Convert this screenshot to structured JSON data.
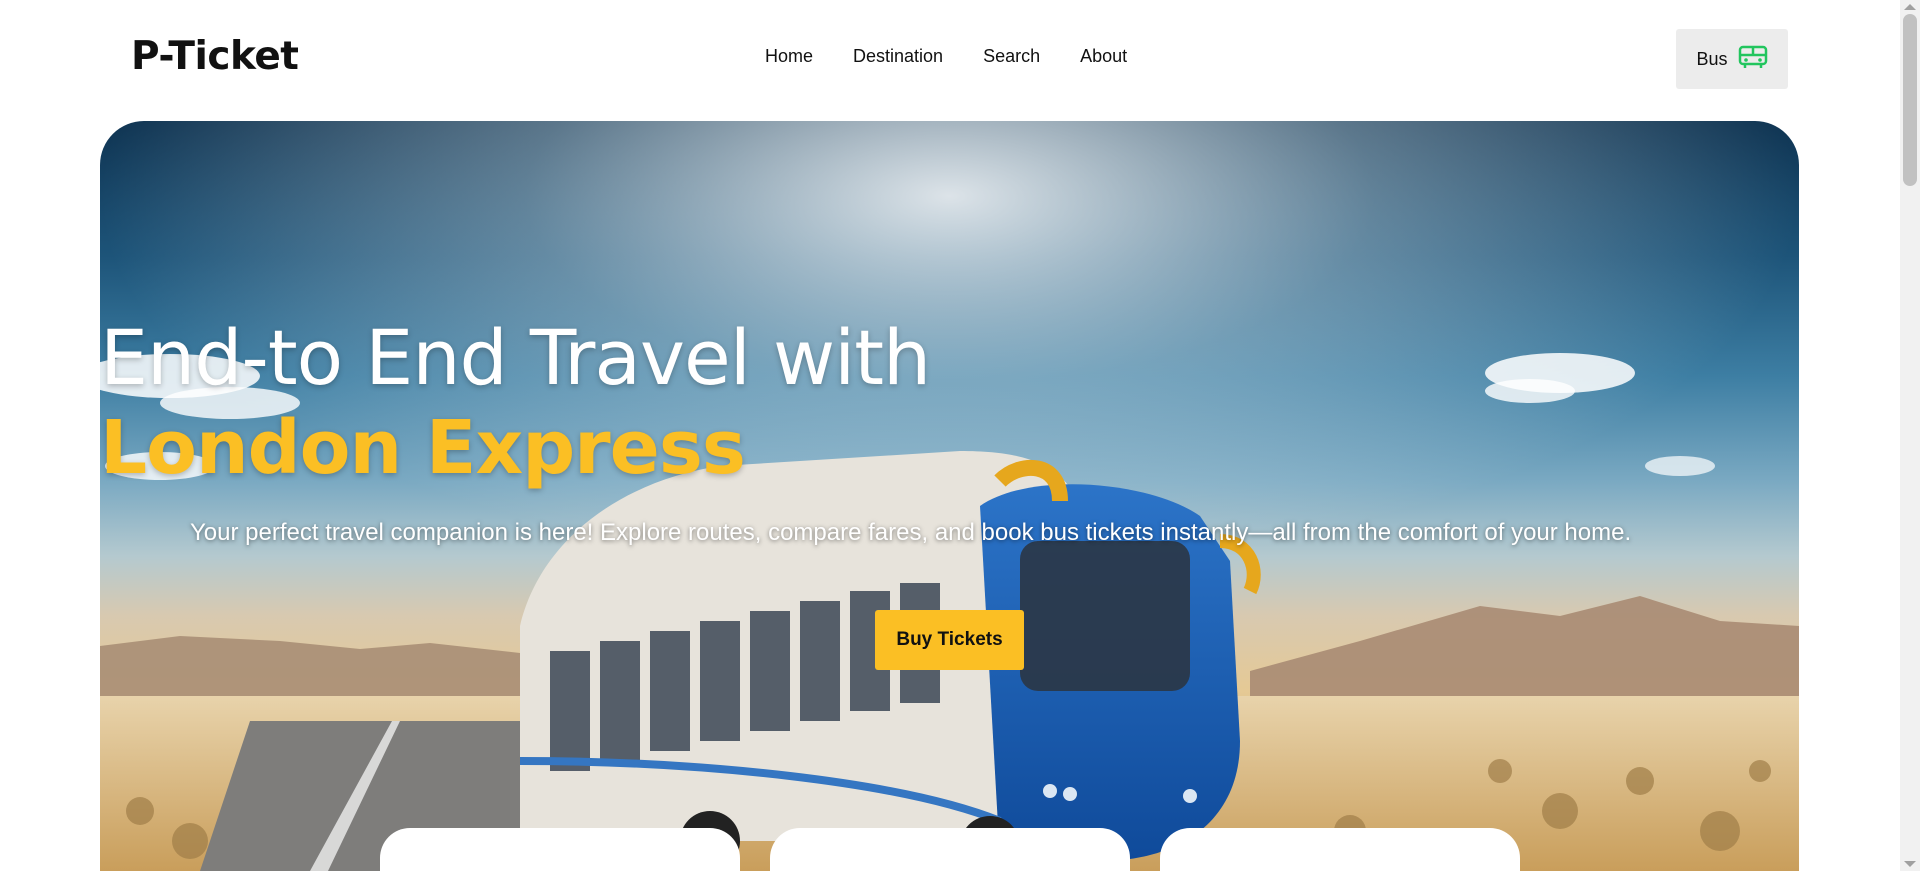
{
  "logo": "P-Ticket",
  "nav": {
    "items": [
      "Home",
      "Destination",
      "Search",
      "About"
    ]
  },
  "bus_button": {
    "label": "Bus",
    "icon": "bus-icon",
    "icon_color": "#22c55e"
  },
  "hero": {
    "title": "End-to End Travel with",
    "highlight": "London Express",
    "subtitle": "Your perfect travel companion is here! Explore routes, compare fares, and book bus tickets instantly—all from the comfort of your home.",
    "cta_label": "Buy Tickets",
    "accent_color": "#fbbf24"
  }
}
